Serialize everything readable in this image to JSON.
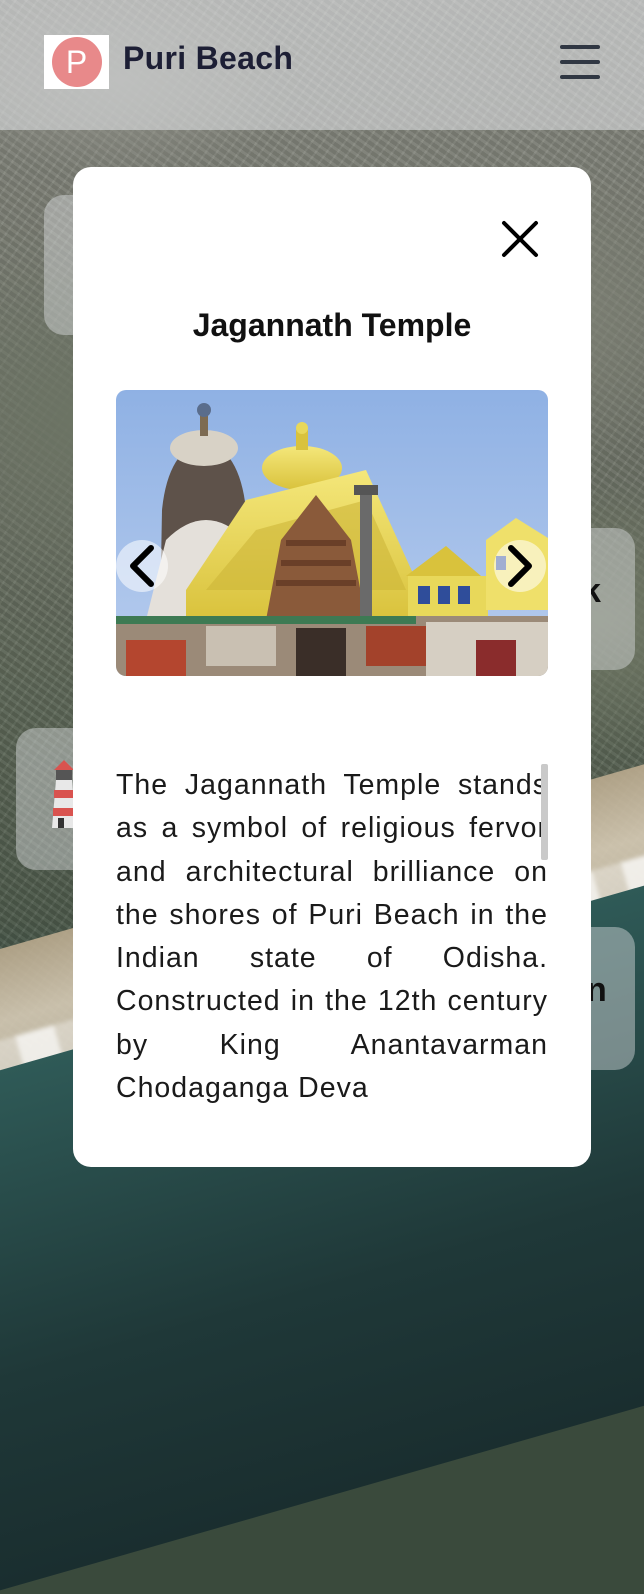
{
  "header": {
    "logo_letter": "P",
    "title": "Puri Beach",
    "menu_icon": "hamburger-icon"
  },
  "background_cards": [
    {
      "label": "k"
    },
    {
      "label": "n"
    }
  ],
  "modal": {
    "title": "Jagannath Temple",
    "close_icon": "close-icon",
    "carousel": {
      "prev_icon": "chevron-left-icon",
      "next_icon": "chevron-right-icon"
    },
    "description": "The Jagannath Temple stands as a symbol of religious fervor and architectural brilliance on the shores of Puri Beach in the Indian state of Odisha. Constructed in the 12th century by King Anantavarman Chodaganga Deva"
  },
  "colors": {
    "logo_circle": "#e8898a",
    "brand_text": "#1d1f35",
    "modal_bg": "#ffffff"
  }
}
